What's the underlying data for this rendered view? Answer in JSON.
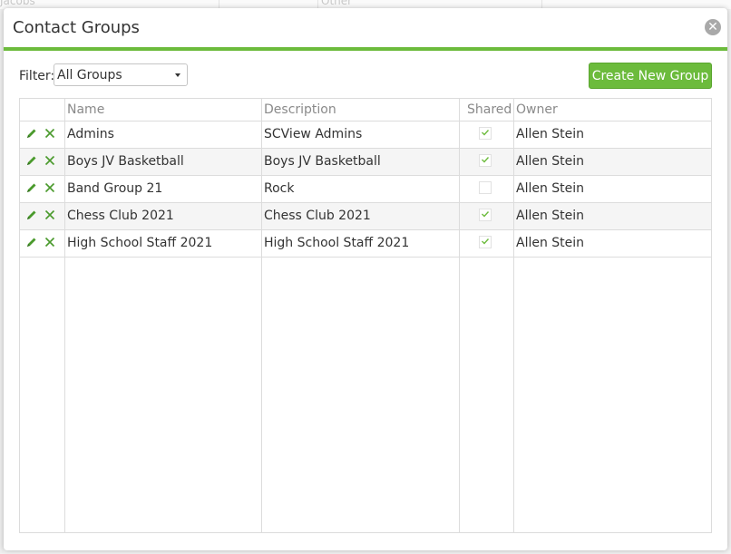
{
  "background": {
    "cells": [
      "Jacobs",
      "Other"
    ]
  },
  "dialog": {
    "title": "Contact Groups",
    "close_glyph": "✕",
    "accent_color": "#6cbb3c"
  },
  "toolbar": {
    "filter_label": "Filter:",
    "filter_value": "All Groups",
    "create_label": "Create New Group"
  },
  "grid": {
    "headers": {
      "name": "Name",
      "description": "Description",
      "shared": "Shared",
      "owner": "Owner"
    },
    "rows": [
      {
        "name": "Admins",
        "description": "SCView Admins",
        "shared": true,
        "owner": "Allen Stein"
      },
      {
        "name": "Boys JV Basketball",
        "description": "Boys JV Basketball",
        "shared": true,
        "owner": "Allen Stein"
      },
      {
        "name": "Band Group 21",
        "description": "Rock",
        "shared": false,
        "owner": "Allen Stein"
      },
      {
        "name": "Chess Club 2021",
        "description": "Chess Club 2021",
        "shared": true,
        "owner": "Allen Stein"
      },
      {
        "name": "High School Staff 2021",
        "description": "High School Staff 2021",
        "shared": true,
        "owner": "Allen Stein"
      }
    ],
    "row_icons": {
      "edit": "pencil-icon",
      "delete": "x-icon"
    }
  }
}
